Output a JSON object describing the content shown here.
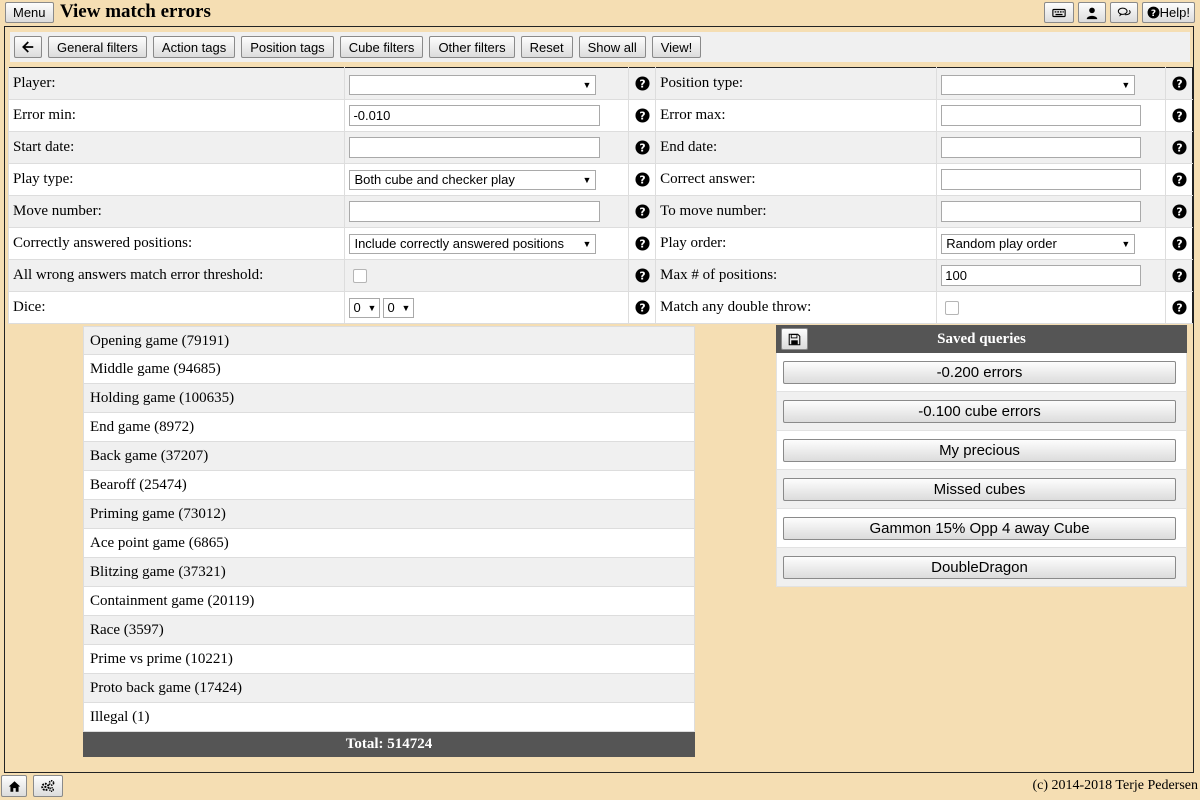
{
  "header": {
    "menu_label": "Menu",
    "title": "View match errors",
    "help_label": "Help!",
    "icons": [
      "keyboard-icon",
      "user-icon",
      "chat-icon",
      "help-circle-icon"
    ]
  },
  "toolbar": {
    "back_icon": "arrow-left-icon",
    "buttons": [
      "General filters",
      "Action tags",
      "Position tags",
      "Cube filters",
      "Other filters",
      "Reset",
      "Show all",
      "View!"
    ]
  },
  "filters": {
    "player": {
      "label": "Player:",
      "value": ""
    },
    "position_type": {
      "label": "Position type:",
      "value": ""
    },
    "error_min": {
      "label": "Error min:",
      "value": "-0.010"
    },
    "error_max": {
      "label": "Error max:",
      "value": ""
    },
    "start_date": {
      "label": "Start date:",
      "value": ""
    },
    "end_date": {
      "label": "End date:",
      "value": ""
    },
    "play_type": {
      "label": "Play type:",
      "value": "Both cube and checker play"
    },
    "correct_answer": {
      "label": "Correct answer:",
      "value": ""
    },
    "move_number": {
      "label": "Move number:",
      "value": ""
    },
    "to_move_number": {
      "label": "To move number:",
      "value": ""
    },
    "correctly_answered": {
      "label": "Correctly answered positions:",
      "value": "Include correctly answered positions"
    },
    "play_order": {
      "label": "Play order:",
      "value": "Random play order"
    },
    "all_wrong": {
      "label": "All wrong answers match error threshold:",
      "checked": false
    },
    "max_positions": {
      "label": "Max # of positions:",
      "value": "100"
    },
    "dice": {
      "label": "Dice:",
      "die1": "0",
      "die2": "0"
    },
    "match_double": {
      "label": "Match any double throw:",
      "checked": false
    }
  },
  "categories": [
    "Opening game (79191)",
    "Middle game (94685)",
    "Holding game (100635)",
    "End game (8972)",
    "Back game (37207)",
    "Bearoff (25474)",
    "Priming game (73012)",
    "Ace point game (6865)",
    "Blitzing game (37321)",
    "Containment game (20119)",
    "Race (3597)",
    "Prime vs prime (10221)",
    "Proto back game (17424)",
    "Illegal (1)"
  ],
  "total": "Total: 514724",
  "saved_queries": {
    "title": "Saved queries",
    "save_icon": "floppy-disk-icon",
    "items": [
      "-0.200 errors",
      "-0.100 cube errors",
      "My precious",
      "Missed cubes",
      "Gammon 15% Opp 4 away Cube",
      "DoubleDragon"
    ]
  },
  "footer": {
    "home_icon": "home-icon",
    "settings_icon": "settings-gears-icon",
    "copyright": "(c) 2014-2018 Terje Pedersen"
  }
}
